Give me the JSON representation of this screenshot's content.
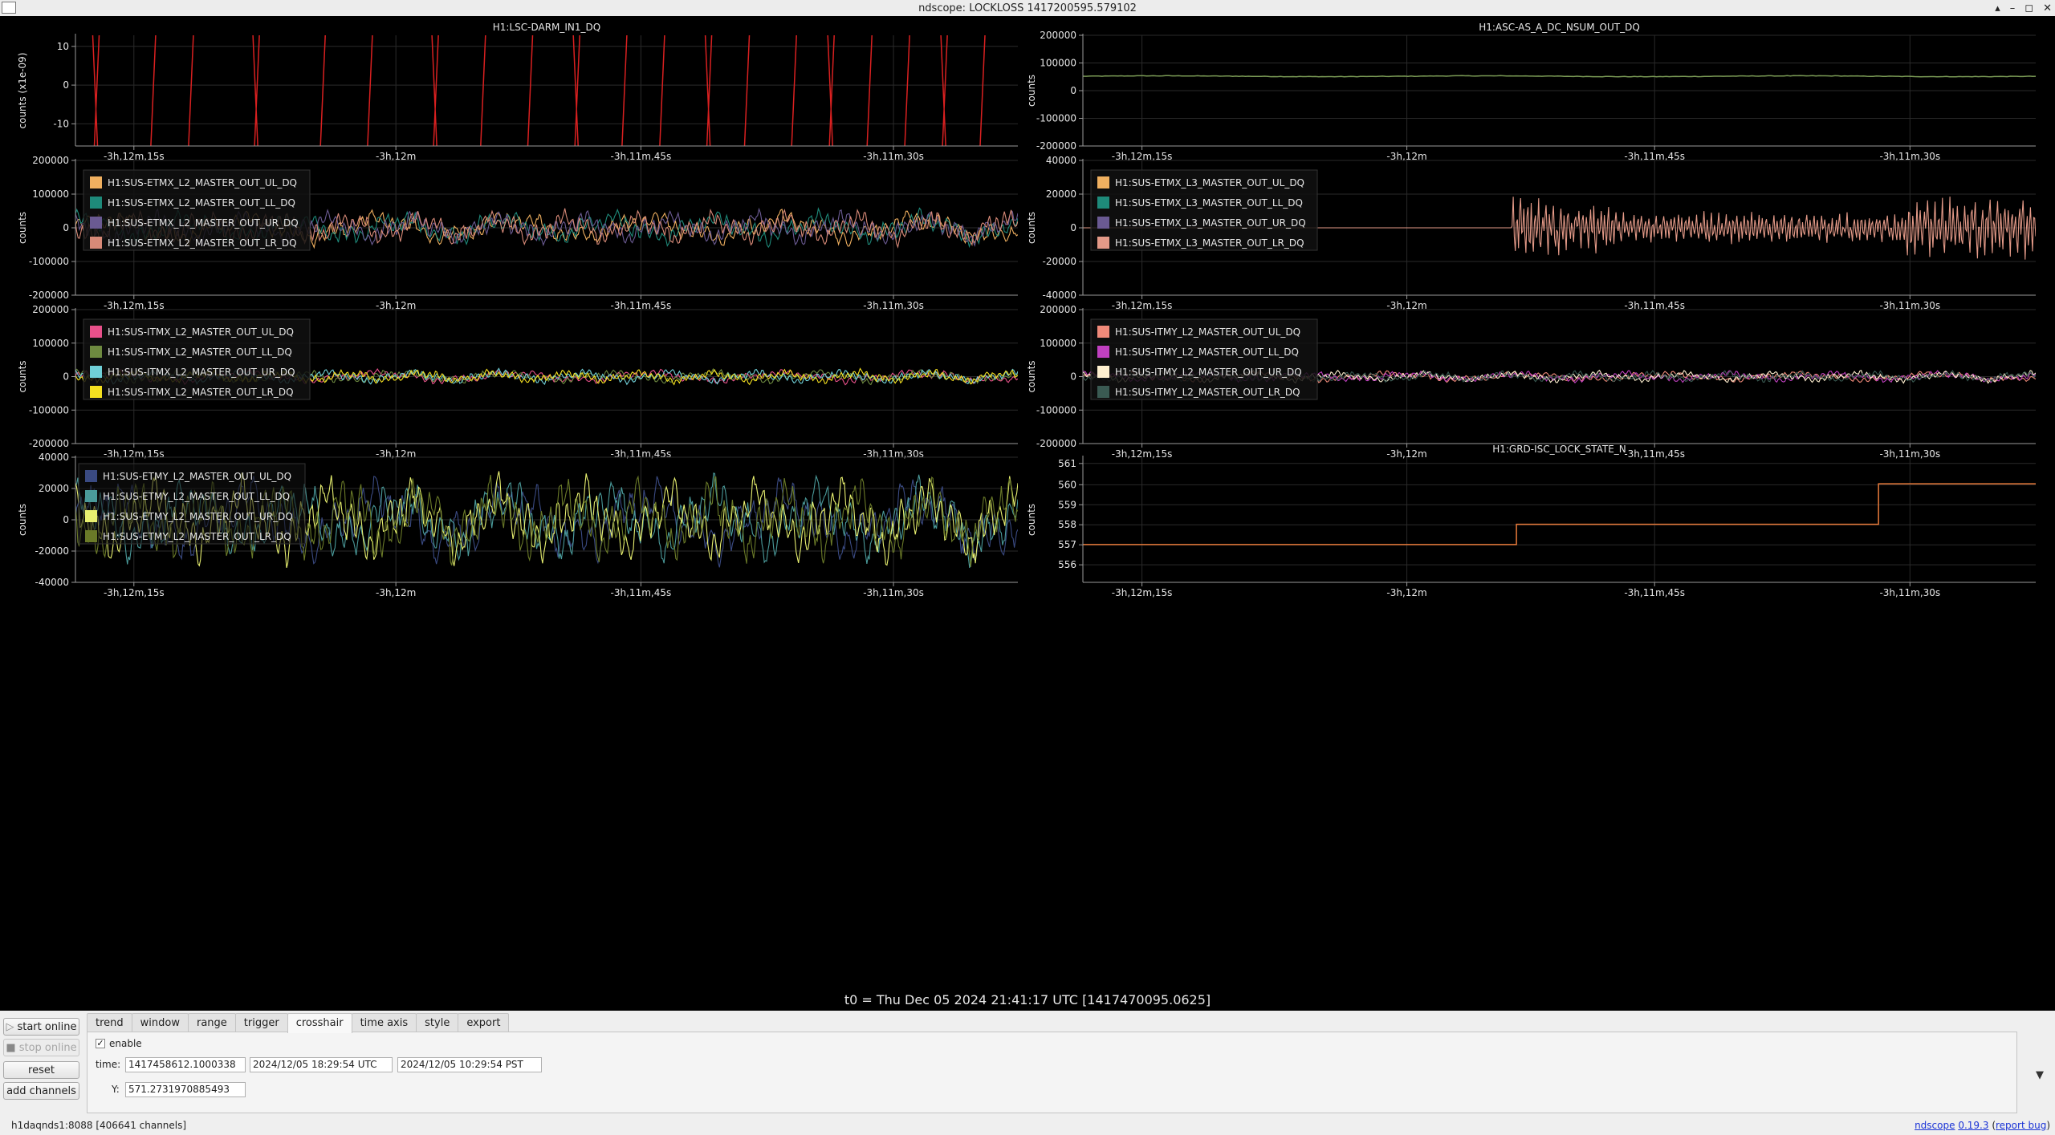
{
  "window": {
    "title": "ndscope: LOCKLOSS 1417200595.579102",
    "minimize": "–",
    "maximize": "◻",
    "close": "✕",
    "restore": "▴"
  },
  "colors": {
    "plot_bg": "#000000",
    "axis": "#9a9a9a",
    "grid": "#2a2a2a",
    "darm": "#d92020",
    "asc": "#7a9a55",
    "lock_state": "#e87a3a"
  },
  "plots": [
    {
      "title": "H1:LSC-DARM_IN1_DQ",
      "ylabel": "counts (x1e-09)",
      "yticks": [
        "10",
        "0",
        "-10"
      ],
      "xticks": [
        "-3h,12m,15s",
        "-3h,12m",
        "-3h,11m,45s",
        "-3h,11m,30s"
      ],
      "legend": []
    },
    {
      "title": "H1:ASC-AS_A_DC_NSUM_OUT_DQ",
      "ylabel": "counts",
      "yticks": [
        "200000",
        "100000",
        "0",
        "-100000",
        "-200000"
      ],
      "xticks": [
        "-3h,12m,15s",
        "-3h,12m",
        "-3h,11m,45s",
        "-3h,11m,30s"
      ],
      "legend": []
    },
    {
      "title": "",
      "ylabel": "counts",
      "yticks": [
        "200000",
        "100000",
        "0",
        "-100000",
        "-200000"
      ],
      "xticks": [
        "-3h,12m,15s",
        "-3h,12m",
        "-3h,11m,45s",
        "-3h,11m,30s"
      ],
      "legend": [
        {
          "name": "H1:SUS-ETMX_L2_MASTER_OUT_UL_DQ",
          "color": "#f0b060"
        },
        {
          "name": "H1:SUS-ETMX_L2_MASTER_OUT_LL_DQ",
          "color": "#1e8a7a"
        },
        {
          "name": "H1:SUS-ETMX_L2_MASTER_OUT_UR_DQ",
          "color": "#6a5a92"
        },
        {
          "name": "H1:SUS-ETMX_L2_MASTER_OUT_LR_DQ",
          "color": "#d88a78"
        }
      ]
    },
    {
      "title": "",
      "ylabel": "counts",
      "yticks": [
        "40000",
        "20000",
        "0",
        "-20000",
        "-40000"
      ],
      "xticks": [
        "-3h,12m,15s",
        "-3h,12m",
        "-3h,11m,45s",
        "-3h,11m,30s"
      ],
      "legend": [
        {
          "name": "H1:SUS-ETMX_L3_MASTER_OUT_UL_DQ",
          "color": "#f0b060"
        },
        {
          "name": "H1:SUS-ETMX_L3_MASTER_OUT_LL_DQ",
          "color": "#1e8a7a"
        },
        {
          "name": "H1:SUS-ETMX_L3_MASTER_OUT_UR_DQ",
          "color": "#6a5a92"
        },
        {
          "name": "H1:SUS-ETMX_L3_MASTER_OUT_LR_DQ",
          "color": "#e49a88"
        }
      ]
    },
    {
      "title": "",
      "ylabel": "counts",
      "yticks": [
        "200000",
        "100000",
        "0",
        "-100000",
        "-200000"
      ],
      "xticks": [
        "-3h,12m,15s",
        "-3h,12m",
        "-3h,11m,45s",
        "-3h,11m,30s"
      ],
      "legend": [
        {
          "name": "H1:SUS-ITMX_L2_MASTER_OUT_UL_DQ",
          "color": "#e8508a"
        },
        {
          "name": "H1:SUS-ITMX_L2_MASTER_OUT_LL_DQ",
          "color": "#6e8a40"
        },
        {
          "name": "H1:SUS-ITMX_L2_MASTER_OUT_UR_DQ",
          "color": "#70d0d8"
        },
        {
          "name": "H1:SUS-ITMX_L2_MASTER_OUT_LR_DQ",
          "color": "#f4e020"
        }
      ]
    },
    {
      "title": "",
      "ylabel": "counts",
      "yticks": [
        "200000",
        "100000",
        "0",
        "-100000",
        "-200000"
      ],
      "xticks": [
        "-3h,12m,15s",
        "-3h,12m",
        "-3h,11m,45s",
        "-3h,11m,30s"
      ],
      "legend": [
        {
          "name": "H1:SUS-ITMY_L2_MASTER_OUT_UL_DQ",
          "color": "#f08a7a"
        },
        {
          "name": "H1:SUS-ITMY_L2_MASTER_OUT_LL_DQ",
          "color": "#c040c0"
        },
        {
          "name": "H1:SUS-ITMY_L2_MASTER_OUT_UR_DQ",
          "color": "#fff0d0"
        },
        {
          "name": "H1:SUS-ITMY_L2_MASTER_OUT_LR_DQ",
          "color": "#3a5a52"
        }
      ]
    },
    {
      "title": "",
      "ylabel": "counts",
      "yticks": [
        "40000",
        "20000",
        "0",
        "-20000",
        "-40000"
      ],
      "xticks": [
        "-3h,12m,15s",
        "-3h,12m",
        "-3h,11m,45s",
        "-3h,11m,30s"
      ],
      "legend": [
        {
          "name": "H1:SUS-ETMY_L2_MASTER_OUT_UL_DQ",
          "color": "#3a4a82"
        },
        {
          "name": "H1:SUS-ETMY_L2_MASTER_OUT_LL_DQ",
          "color": "#4a9a9a"
        },
        {
          "name": "H1:SUS-ETMY_L2_MASTER_OUT_UR_DQ",
          "color": "#e8f070"
        },
        {
          "name": "H1:SUS-ETMY_L2_MASTER_OUT_LR_DQ",
          "color": "#6a7a28"
        }
      ]
    },
    {
      "title": "H1:GRD-ISC_LOCK_STATE_N",
      "ylabel": "counts",
      "yticks": [
        "561",
        "560",
        "559",
        "558",
        "557",
        "556"
      ],
      "xticks": [
        "-3h,12m,15s",
        "-3h,12m",
        "-3h,11m,45s",
        "-3h,11m,30s"
      ],
      "legend": []
    }
  ],
  "t0_label": "t0 = Thu Dec 05 2024 21:41:17 UTC [1417470095.0625]",
  "side_buttons": {
    "start_online": "start online",
    "stop_online": "stop online",
    "reset": "reset",
    "add_channels": "add channels"
  },
  "tabs": [
    "trend",
    "window",
    "range",
    "trigger",
    "crosshair",
    "time axis",
    "style",
    "export"
  ],
  "active_tab": "crosshair",
  "crosshair": {
    "enable_label": "enable",
    "enabled": true,
    "time_label": "time:",
    "time_gps": "1417458612.1000338",
    "time_utc": "2024/12/05 18:29:54 UTC",
    "time_pst": "2024/12/05 10:29:54 PST",
    "y_label": "Y:",
    "y_value": "571.2731970885493"
  },
  "status": {
    "server": "h1daqnds1:8088  [406641 channels]",
    "app_link": "ndscope",
    "version_link": "0.19.3",
    "report_open": "(",
    "report_link": "report bug",
    "report_close": ")"
  }
}
